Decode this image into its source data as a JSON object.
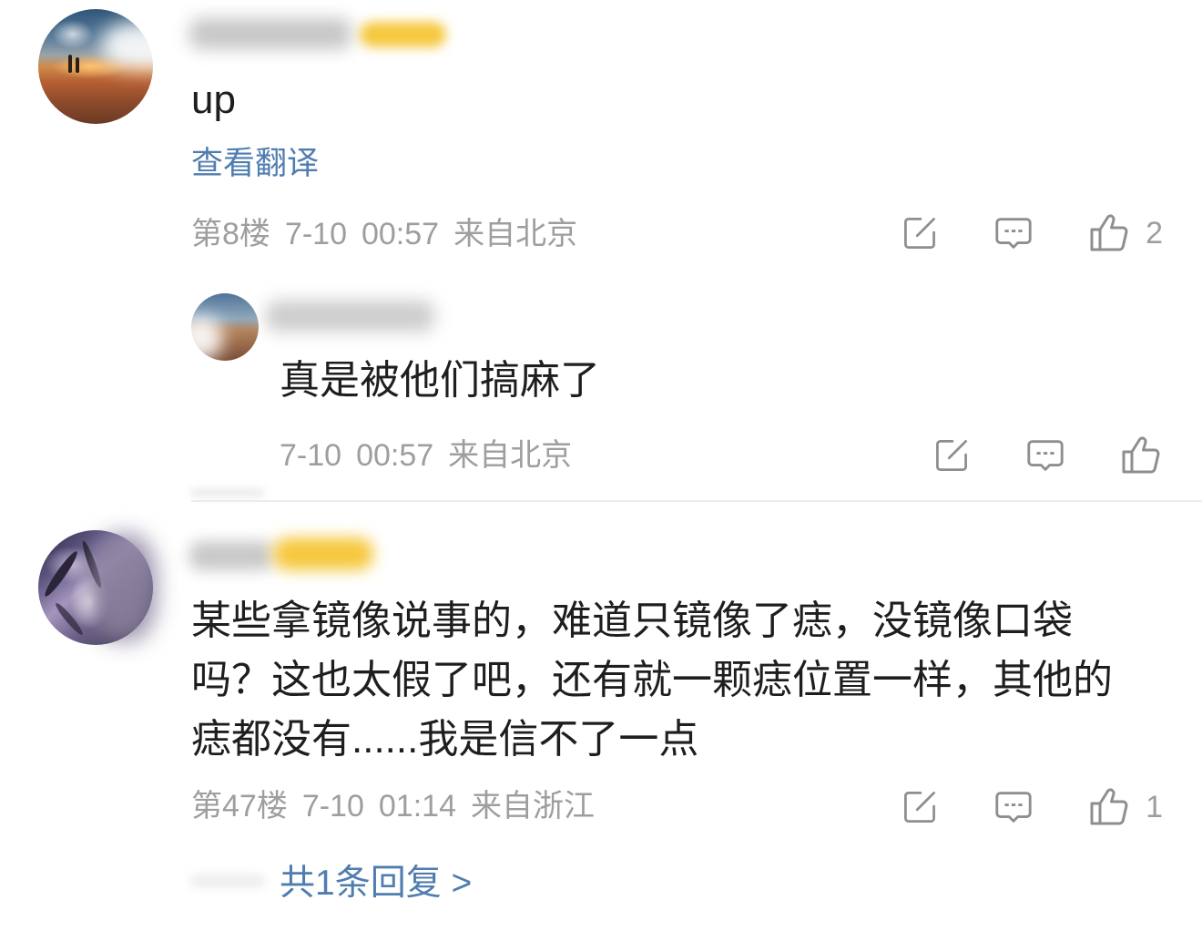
{
  "colors": {
    "text": "#1e1e1e",
    "meta": "#9e9e9e",
    "link": "#507daf",
    "icon": "#8e8e8e",
    "divider": "#ececec",
    "badge": "#f6c83e"
  },
  "icons": {
    "repost": "repost-icon",
    "reply": "comment-icon",
    "like": "thumbs-up-icon"
  },
  "comments": [
    {
      "text": "up",
      "translate_link": "查看翻译",
      "floor": "第8楼",
      "date": "7-10",
      "time": "00:57",
      "location": "来自北京",
      "like_count": "2",
      "replies": [
        {
          "text": "真是被他们搞麻了",
          "date": "7-10",
          "time": "00:57",
          "location": "来自北京"
        }
      ]
    },
    {
      "text": "某些拿镜像说事的，难道只镜像了痣，没镜像口袋吗？这也太假了吧，还有就一颗痣位置一样，其他的痣都没有......我是信不了一点",
      "floor": "第47楼",
      "date": "7-10",
      "time": "01:14",
      "location": "来自浙江",
      "like_count": "1",
      "reply_summary": "共1条回复 >"
    }
  ]
}
